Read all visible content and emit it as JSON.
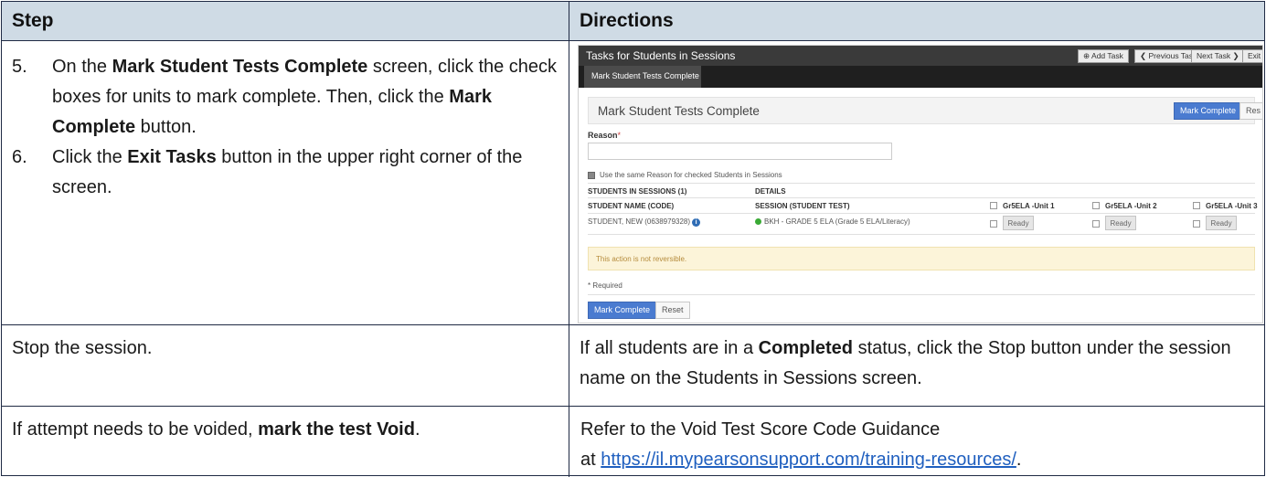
{
  "headers": {
    "step": "Step",
    "directions": "Directions"
  },
  "rows": [
    {
      "steps": [
        {
          "num": "5.",
          "parts": [
            "On the ",
            "Mark Student Tests Complete",
            " screen, click the check boxes for units to mark complete. Then, click the ",
            "Mark Complete",
            " button."
          ]
        },
        {
          "num": "6.",
          "parts": [
            "Click the ",
            "Exit Tasks",
            " button in the upper right corner of the screen."
          ]
        }
      ]
    },
    {
      "step": "Stop the session.",
      "directions_parts": [
        "If all students are in a ",
        "Completed",
        " status, click the Stop button under the session name on the Students in Sessions screen."
      ]
    },
    {
      "step_parts": [
        "If attempt needs to be voided, ",
        "mark the test Void",
        "."
      ],
      "directions_line1": "Refer to the Void Test Score Code Guidance",
      "directions_line2_prefix": "at ",
      "link": "https://il.mypearsonsupport.com/training-resources/",
      "link_suffix": "."
    }
  ],
  "screenshot": {
    "title": "Tasks for Students in Sessions",
    "buttons": {
      "add_task": "Add Task",
      "previous_task": "Previous Task",
      "next_task": "Next Task",
      "exit_tasks": "Exit Task"
    },
    "tab": "Mark Student Tests Complete",
    "panel_title": "Mark Student Tests Complete",
    "mark_complete": "Mark Complete",
    "reset_partial": "Res",
    "reason_label": "Reason",
    "required_star": "*",
    "same_reason": "Use the same Reason for checked Students in Sessions",
    "table": {
      "group1": "STUDENTS IN SESSIONS (1)",
      "group2": "DETAILS",
      "col_student": "STUDENT NAME (CODE)",
      "col_session": "SESSION (STUDENT TEST)",
      "units": [
        "Gr5ELA -Unit 1",
        "Gr5ELA -Unit 2",
        "Gr5ELA -Unit 3"
      ],
      "student": "STUDENT, NEW (0638979328)",
      "session": "BKH - GRADE 5 ELA (Grade 5 ELA/Literacy)",
      "status": "Ready"
    },
    "warning": "This action is not reversible.",
    "required_note": "* Required",
    "bottom_mark_complete": "Mark Complete",
    "bottom_reset": "Reset",
    "colors": {
      "primary_blue": "#4a7bd0",
      "top_bar": "#3a3a3a",
      "warning_bg": "#fcf4d9",
      "header_fill": "#cfdbe5"
    }
  }
}
